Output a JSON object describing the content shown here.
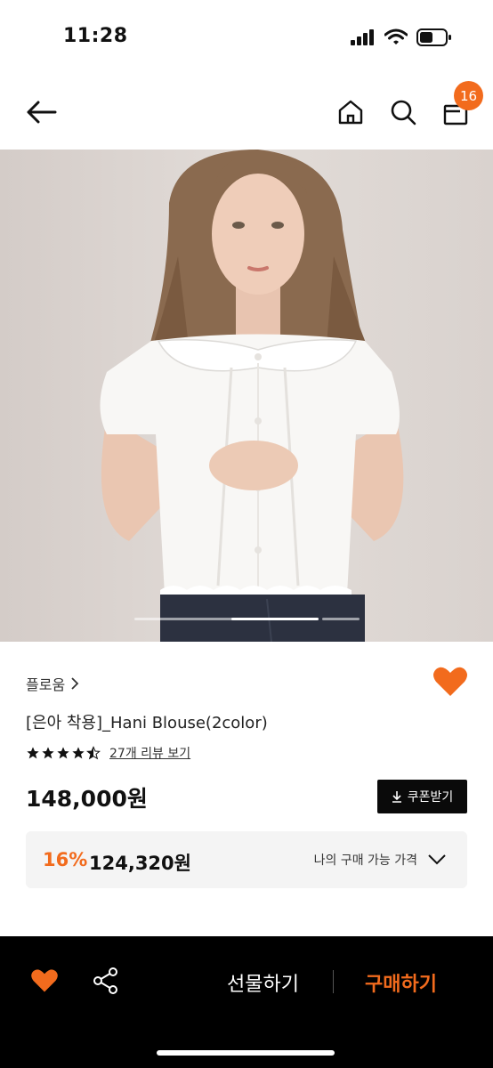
{
  "status_bar": {
    "time": "11:28"
  },
  "header": {
    "cart_count": "16"
  },
  "product": {
    "brand": "플로움",
    "title": "[은아 착용]_Hani Blouse(2color)",
    "rating": 4.5,
    "review_link": "27개 리뷰 보기",
    "price": "148,000원",
    "coupon_label": "쿠폰받기",
    "discount_percent": "16%",
    "discounted_price": "124,320원",
    "my_price_label": "나의 구매 가능 가격"
  },
  "carousel": {
    "current_index": 1,
    "count": 3
  },
  "bottom_bar": {
    "gift_label": "선물하기",
    "buy_label": "구매하기"
  },
  "colors": {
    "accent": "#f26b1d",
    "bar": "#000000"
  }
}
